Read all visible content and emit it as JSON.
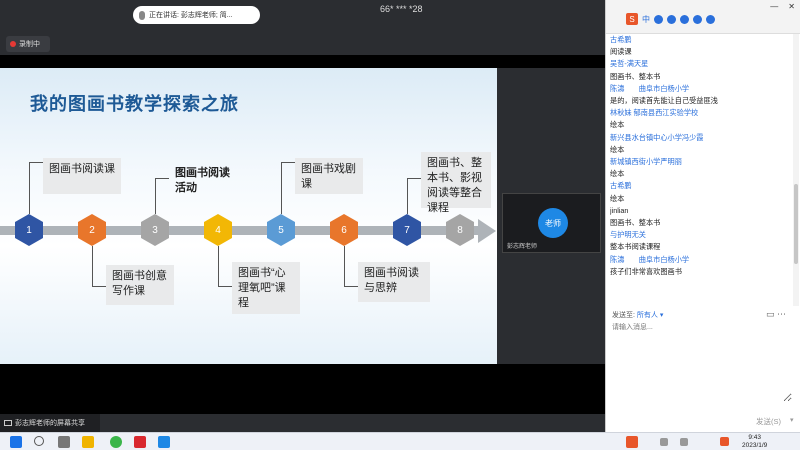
{
  "meeting": {
    "speaking_label": "正在讲话: 彭志辉老师; 简...",
    "meeting_id": "66* *** *28",
    "recording_label": "录制中",
    "screen_share_label": "彭志辉老师的屏幕共享",
    "presenter": {
      "avatar_text": "老师",
      "name": "彭志辉老师"
    }
  },
  "slide": {
    "title": "我的图画书教学探索之旅",
    "nodes": [
      {
        "num": "1",
        "color": "#2f55a4"
      },
      {
        "num": "2",
        "color": "#e8762b"
      },
      {
        "num": "3",
        "color": "#a5a5a5"
      },
      {
        "num": "4",
        "color": "#f2b705"
      },
      {
        "num": "5",
        "color": "#5b9bd5"
      },
      {
        "num": "6",
        "color": "#e8762b"
      },
      {
        "num": "7",
        "color": "#2f55a4"
      },
      {
        "num": "8",
        "color": "#a5a5a5"
      }
    ],
    "labels": {
      "l1": "图画书阅读课",
      "l2": "图画书创意写作课",
      "l3": "图画书阅读活动",
      "l4": "图画书“心理氧吧”课程",
      "l5": "图画书戏剧课",
      "l6": "图画书阅读与思辨",
      "l7": "图画书、整本书、影视阅读等整合课程"
    }
  },
  "chat": {
    "title": "聊天",
    "messages": [
      {
        "sender": "古希鹏",
        "text": "阅读课"
      },
      {
        "sender": "吴哲-满天星",
        "text": "图画书、整本书"
      },
      {
        "sender": "陈濤　　曲阜市白杨小学",
        "text": "是的，阅读首先能让自己受益匪浅"
      },
      {
        "sender": "林秋妹 郁南县西江实验学校",
        "text": "绘本"
      },
      {
        "sender": "新兴县水台镇中心小学冯少霞",
        "text": "绘本"
      },
      {
        "sender": "新城镇西街小学严明丽",
        "text": "绘本"
      },
      {
        "sender": "古希鹏",
        "text": "绘本"
      },
      {
        "sender": "jinlian",
        "text": "图画书、整本书"
      },
      {
        "sender": "与护明无关",
        "text": "整本书阅读课程"
      },
      {
        "sender": "陈濤　　曲阜市白杨小学",
        "text": "孩子们非常喜欢图画书"
      }
    ],
    "send_to_label": "发送至:",
    "send_to_target": "所有人",
    "input_placeholder": "请输入消息...",
    "send_button": "发送(S)"
  },
  "taskbar": {
    "time": "9:43",
    "date": "2023/1/9"
  }
}
